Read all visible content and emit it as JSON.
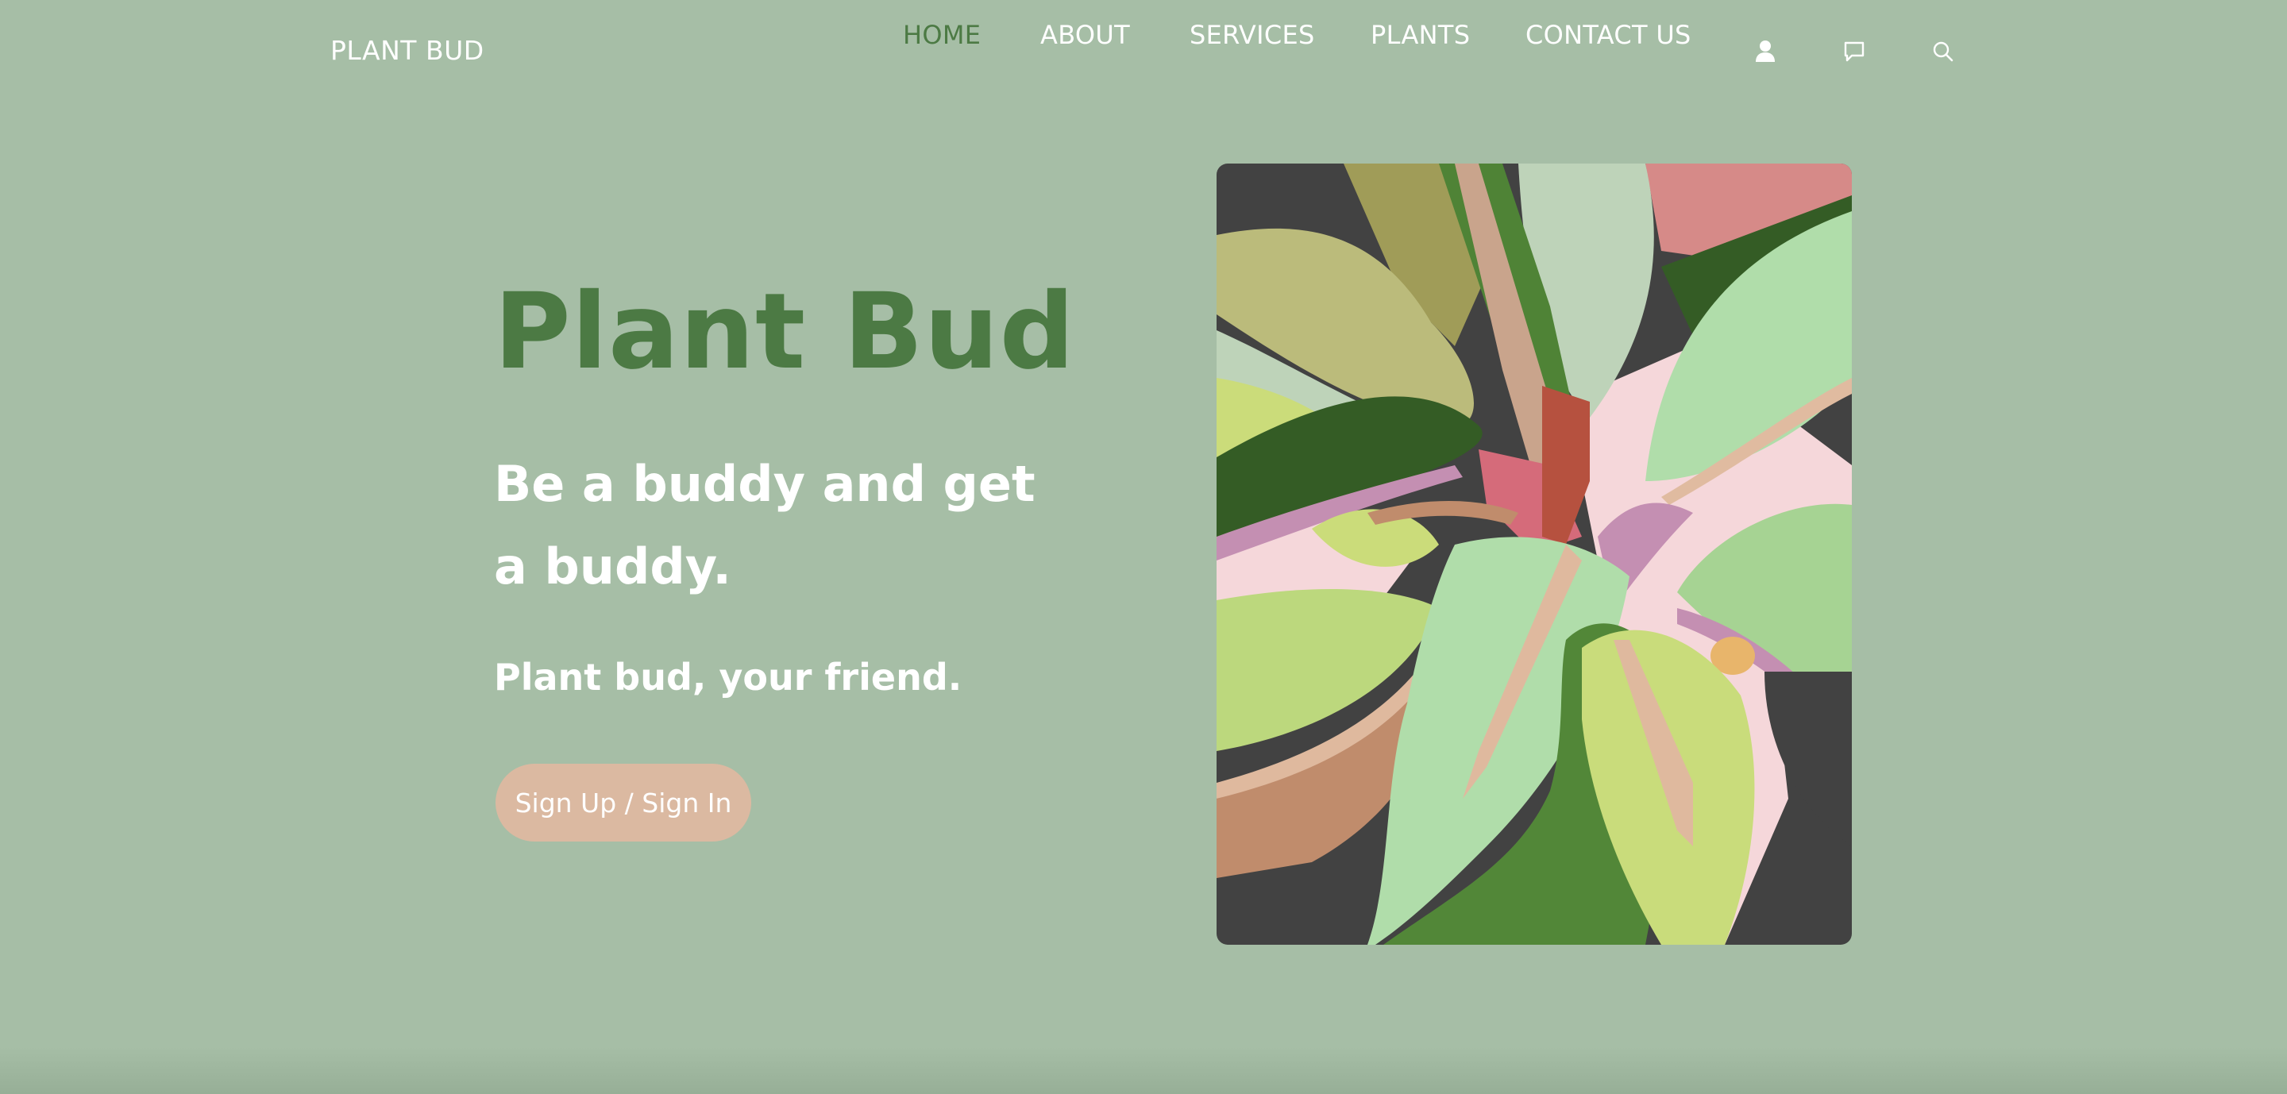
{
  "nav": {
    "brand": "PLANT BUD",
    "links": [
      {
        "label": "HOME",
        "active": true
      },
      {
        "label": "ABOUT",
        "active": false
      },
      {
        "label": "SERVICES",
        "active": false
      },
      {
        "label": "PLANTS",
        "active": false
      },
      {
        "label": "CONTACT US",
        "active": false
      }
    ],
    "icons": [
      "user-icon",
      "chat-icon",
      "search-icon"
    ]
  },
  "hero": {
    "title": "Plant Bud",
    "subtitle": "Be a buddy and get a buddy.",
    "tagline": "Plant bud, your friend.",
    "cta_label": "Sign Up / Sign In"
  },
  "colors": {
    "background": "#a6bea6",
    "accent_green": "#4c7a44",
    "cta_peach": "#dbb9a1",
    "text_white": "#ffffff"
  }
}
